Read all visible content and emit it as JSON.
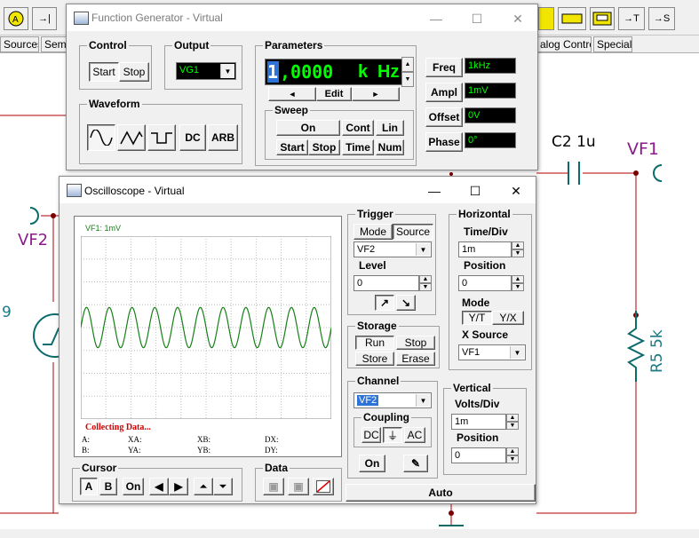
{
  "workspace": {
    "tabs": [
      "Sources",
      "Sem",
      "alog Control",
      "Special"
    ],
    "toolbar_right": [
      "→T",
      "→S"
    ]
  },
  "schematic": {
    "labels": {
      "c2": "C2 1u",
      "vf1": "VF1",
      "vf2": "VF2",
      "r5": "R5 5k",
      "num": "9"
    },
    "colors": {
      "teal": "#1a7a86",
      "purple": "#8b1a8b",
      "wire": "#b00000"
    }
  },
  "function_generator": {
    "title": "Function Generator - Virtual",
    "control": {
      "label": "Control",
      "start": "Start",
      "stop": "Stop"
    },
    "output": {
      "label": "Output",
      "value": "VG1"
    },
    "waveform": {
      "label": "Waveform",
      "dc": "DC",
      "arb": "ARB"
    },
    "parameters": {
      "label": "Parameters",
      "display_first": "1",
      "display_rest": ",0000",
      "display_prefix": "k",
      "display_unit": "Hz",
      "edit": "Edit",
      "left_arrow": "◄",
      "right_arrow": "►"
    },
    "sweep": {
      "label": "Sweep",
      "on": "On",
      "cont": "Cont",
      "lin": "Lin",
      "start": "Start",
      "stop": "Stop",
      "time": "Time",
      "num": "Num"
    },
    "fields": {
      "freq_label": "Freq",
      "freq": "1kHz",
      "ampl_label": "Ampl",
      "ampl": "1mV",
      "offset_label": "Offset",
      "offset": "0V",
      "phase_label": "Phase",
      "phase": "0°"
    }
  },
  "oscilloscope": {
    "title": "Oscilloscope - Virtual",
    "screen": {
      "trace_label": "VF1: 1mV",
      "status": "Collecting Data...",
      "readouts": {
        "a": "A:",
        "b": "B:",
        "xa": "XA:",
        "ya": "YA:",
        "xb": "XB:",
        "yb": "YB:",
        "dx": "DX:",
        "dy": "DY:"
      },
      "trace_color": "#168016",
      "background": "#ffffff",
      "grid_color": "#bdbdbd",
      "cycles": 11
    },
    "trigger": {
      "label": "Trigger",
      "mode": "Mode",
      "source": "Source",
      "source_value": "VF2",
      "level_label": "Level",
      "level_value": "0"
    },
    "horizontal": {
      "label": "Horizontal",
      "time_div_label": "Time/Div",
      "time_div": "1m",
      "position_label": "Position",
      "position": "0",
      "mode_label": "Mode",
      "yt": "Y/T",
      "yx": "Y/X",
      "xsource_label": "X Source",
      "xsource": "VF1"
    },
    "storage": {
      "label": "Storage",
      "run": "Run",
      "stop": "Stop",
      "store": "Store",
      "erase": "Erase"
    },
    "channel": {
      "label": "Channel",
      "value": "VF2",
      "coupling_label": "Coupling",
      "dc": "DC",
      "ac": "AC",
      "on": "On"
    },
    "vertical": {
      "label": "Vertical",
      "volts_div_label": "Volts/Div",
      "volts_div": "1m",
      "position_label": "Position",
      "position": "0"
    },
    "cursor": {
      "label": "Cursor",
      "a": "A",
      "b": "B",
      "on": "On"
    },
    "data": {
      "label": "Data"
    },
    "auto": "Auto"
  }
}
